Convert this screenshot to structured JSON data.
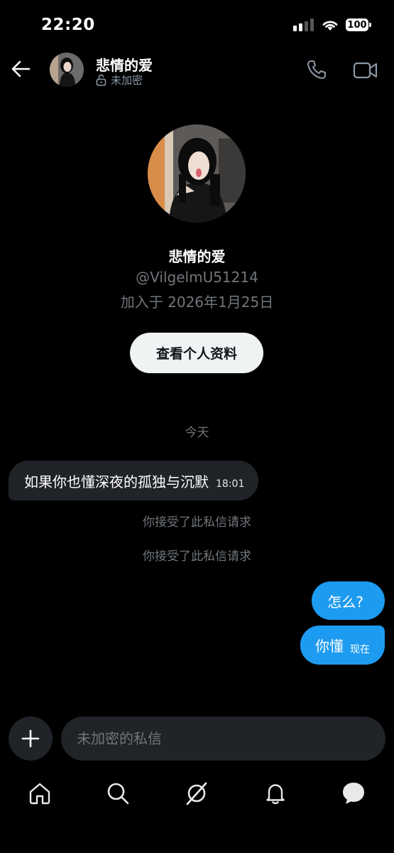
{
  "status_bar": {
    "time": "22:20",
    "battery": "100"
  },
  "header": {
    "name": "悲情的爱",
    "encryption": "未加密"
  },
  "profile": {
    "name": "悲情的爱",
    "handle": "@VilgelmU51214",
    "joined": "加入于 2026年1月25日",
    "view_profile_label": "查看个人资料"
  },
  "conversation": {
    "date_divider": "今天",
    "incoming": {
      "text": "如果你也懂深夜的孤独与沉默",
      "time": "18:01"
    },
    "system_messages": [
      "你接受了此私信请求",
      "你接受了此私信请求"
    ],
    "outgoing": [
      {
        "text": "怎么?"
      },
      {
        "text": "你懂",
        "time": "现在"
      }
    ]
  },
  "composer": {
    "placeholder": "未加密的私信"
  },
  "nav": [
    "home-icon",
    "search-icon",
    "grok-icon",
    "notifications-icon",
    "messages-icon"
  ],
  "colors": {
    "accent": "#1d9bf0",
    "background": "#000000",
    "bubble_incoming": "#202327"
  }
}
